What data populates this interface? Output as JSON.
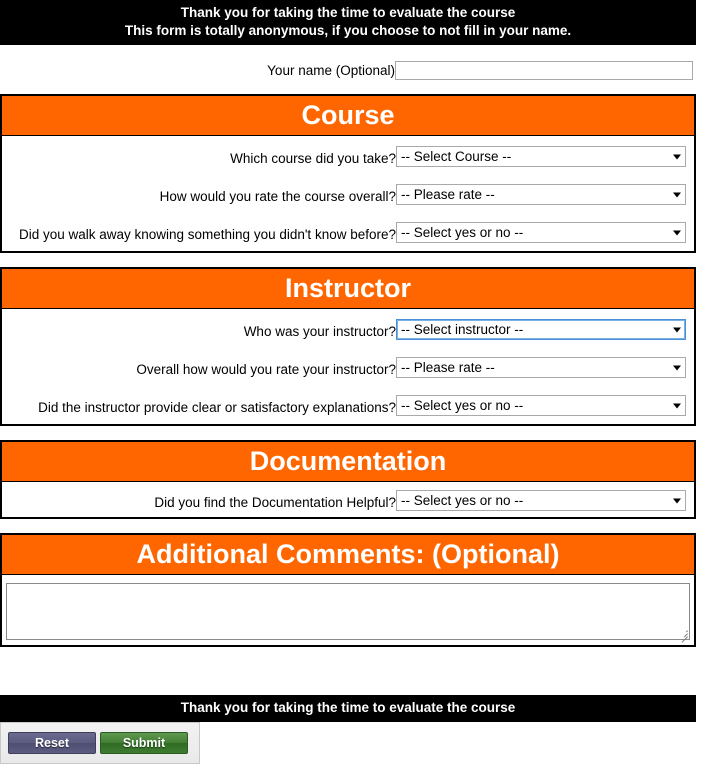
{
  "header": {
    "line1": "Thank you for taking the time to evaluate the course",
    "line2": "This form is totally anonymous, if you choose to not fill in your name."
  },
  "name_field": {
    "label": "Your name (Optional)",
    "value": "",
    "placeholder": ""
  },
  "sections": [
    {
      "title": "Course",
      "fields": [
        {
          "label": "Which course did you take?",
          "value": "-- Select Course --",
          "focused": false
        },
        {
          "label": "How would you rate the course overall?",
          "value": "-- Please rate --",
          "focused": false
        },
        {
          "label": "Did you walk away knowing something you didn't know before?",
          "value": "-- Select yes or no --",
          "focused": false
        }
      ]
    },
    {
      "title": "Instructor",
      "fields": [
        {
          "label": "Who was your instructor?",
          "value": "-- Select instructor --",
          "focused": true
        },
        {
          "label": "Overall how would you rate your instructor?",
          "value": "-- Please rate --",
          "focused": false
        },
        {
          "label": "Did the instructor provide clear or satisfactory explanations?",
          "value": "-- Select yes or no --",
          "focused": false
        }
      ]
    },
    {
      "title": "Documentation",
      "fields": [
        {
          "label": "Did you find the Documentation Helpful?",
          "value": "-- Select yes or no --",
          "focused": false
        }
      ]
    }
  ],
  "comments": {
    "title": "Additional Comments: (Optional)",
    "value": "",
    "placeholder": ""
  },
  "footer": {
    "message": "Thank you for taking the time to evaluate the course",
    "reset_label": "Reset",
    "submit_label": "Submit"
  },
  "colors": {
    "accent_orange": "#ff6600",
    "banner_black": "#000000",
    "focus_blue": "#4a90d9",
    "submit_green": "#417f33",
    "reset_purple": "#5b5b80"
  }
}
